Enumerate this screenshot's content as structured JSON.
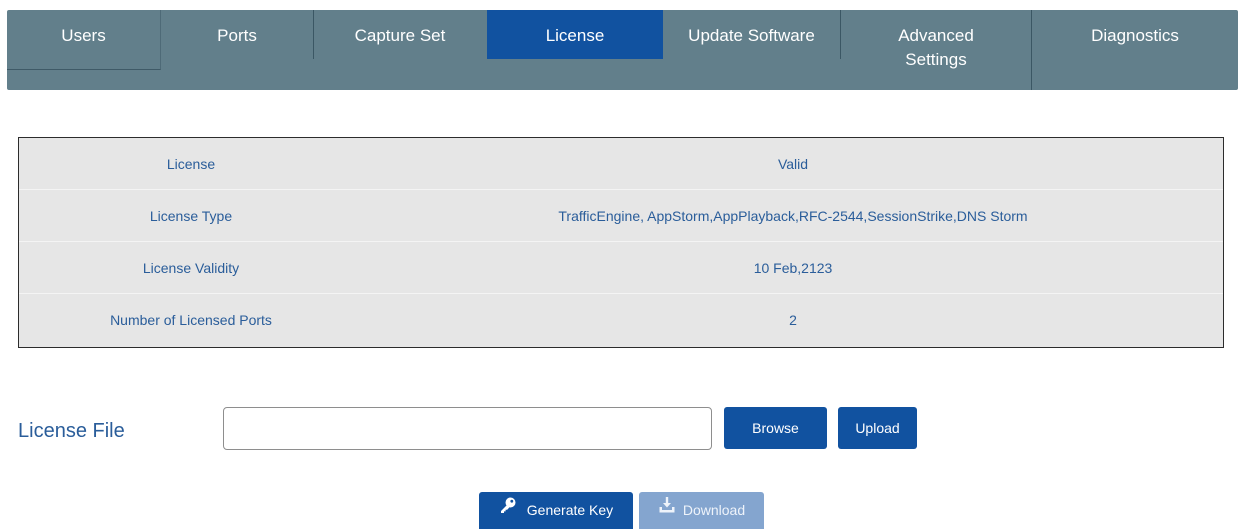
{
  "tabs": {
    "users": "Users",
    "ports": "Ports",
    "capture_set": "Capture Set",
    "license": "License",
    "update_software": "Update Software",
    "advanced_line1": "Advanced",
    "advanced_line2": "Settings",
    "diagnostics": "Diagnostics"
  },
  "license_info": {
    "rows": [
      {
        "label": "License",
        "value": "Valid"
      },
      {
        "label": "License Type",
        "value": "TrafficEngine, AppStorm,AppPlayback,RFC-2544,SessionStrike,DNS Storm"
      },
      {
        "label": "License Validity",
        "value": "10 Feb,2123"
      },
      {
        "label": "Number of Licensed Ports",
        "value": "2"
      }
    ]
  },
  "license_file": {
    "label": "License File",
    "input_value": "",
    "browse_label": "Browse",
    "upload_label": "Upload"
  },
  "actions": {
    "generate_key_label": "Generate Key",
    "download_label": "Download"
  },
  "icons": {
    "generate_key": "key-icon",
    "download": "download-icon"
  },
  "colors": {
    "tabbar_bg": "#627f8b",
    "active_tab": "#1152a0",
    "primary_button": "#1152a0",
    "disabled_button": "#84a5cf",
    "label_text": "#2a5d9a",
    "table_bg": "#e6e6e6"
  }
}
